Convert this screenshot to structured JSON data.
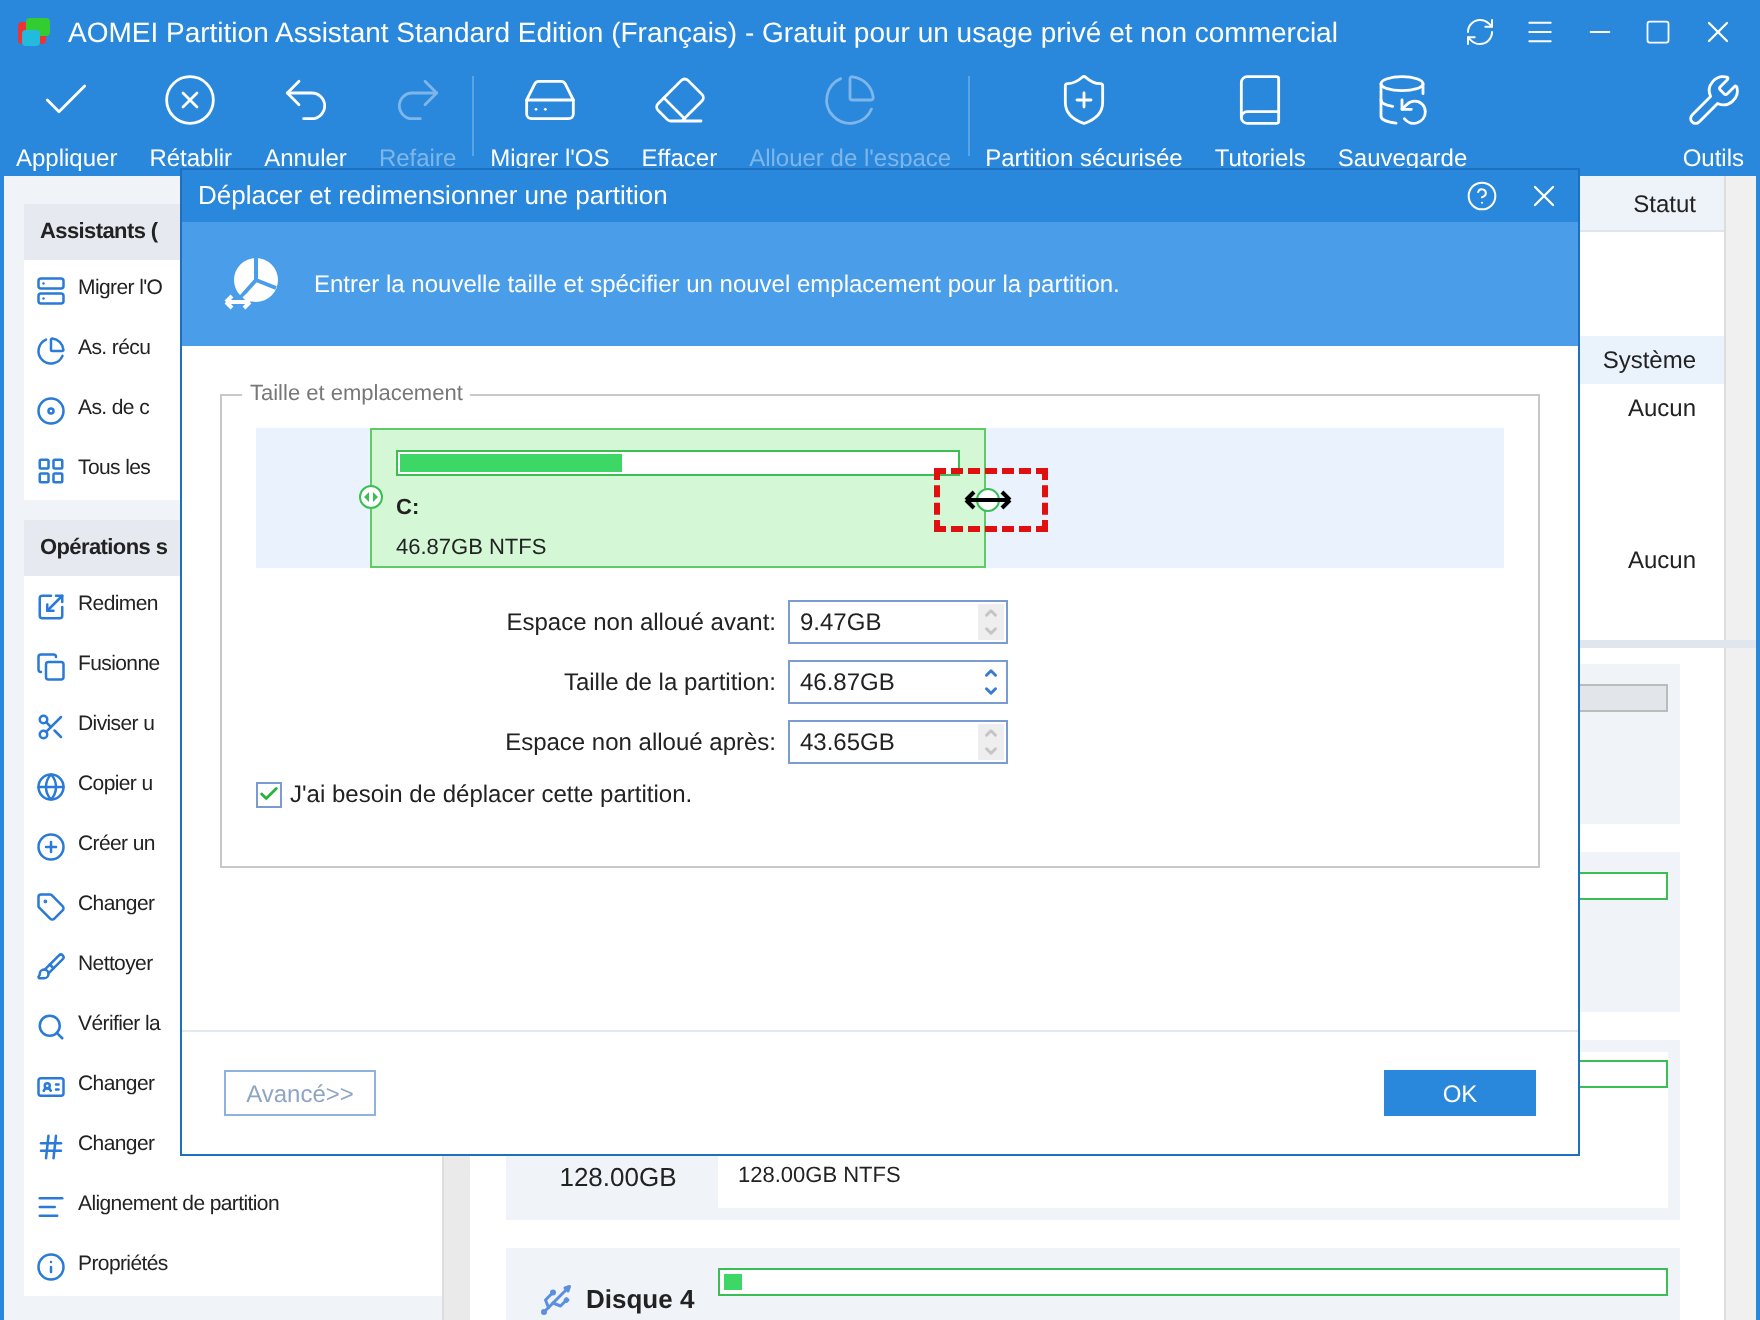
{
  "window": {
    "title": "AOMEI Partition Assistant Standard Edition (Français) - Gratuit pour un usage privé et non commercial"
  },
  "toolbar": [
    {
      "label": "Appliquer",
      "disabled": false
    },
    {
      "label": "Rétablir",
      "disabled": false
    },
    {
      "label": "Annuler",
      "disabled": false
    },
    {
      "label": "Refaire",
      "disabled": true
    },
    {
      "label": "Migrer l'OS",
      "disabled": false
    },
    {
      "label": "Effacer",
      "disabled": false
    },
    {
      "label": "Allouer de l'espace",
      "disabled": true
    },
    {
      "label": "Partition sécurisée",
      "disabled": false
    },
    {
      "label": "Tutoriels",
      "disabled": false
    },
    {
      "label": "Sauvegarde",
      "disabled": false
    },
    {
      "label": "Outils",
      "disabled": false
    }
  ],
  "sidebar": [
    {
      "title": "Assistants (",
      "items": [
        "Migrer l'O",
        "As. récu",
        "As. de c",
        "Tous les"
      ]
    },
    {
      "title": "Opérations s",
      "items": [
        "Redimen",
        "Fusionne",
        "Diviser u",
        "Copier u",
        "Créer un",
        "Changer",
        "Nettoyer",
        "Vérifier la",
        "Changer",
        "Changer",
        "Alignement de partition",
        "Propriétés"
      ]
    }
  ],
  "disk_table": {
    "columns": [
      "Statut"
    ],
    "rows": [
      {
        "status": "Système",
        "selected": true
      },
      {
        "status": "Aucun",
        "selected": false
      },
      {
        "status": "Aucun",
        "selected": false
      }
    ]
  },
  "disk_map": [
    {
      "capacity": "128.00GB",
      "partition": "128.00GB NTFS"
    },
    {
      "name": "Disque 4",
      "level": 0.02
    }
  ],
  "dialog": {
    "title": "Déplacer et redimensionner une partition",
    "description": "Entrer la nouvelle taille et spécifier un nouvel emplacement pour la partition.",
    "group_title": "Taille et emplacement",
    "partition": {
      "letter": "C:",
      "info": "46.87GB NTFS",
      "level": 0.4
    },
    "fields": [
      {
        "label": "Espace non alloué avant:",
        "value": "9.47GB",
        "disabled": true
      },
      {
        "label": "Taille de la partition:",
        "value": "46.87GB",
        "disabled": false
      },
      {
        "label": "Espace non alloué après:",
        "value": "43.65GB",
        "disabled": true
      }
    ],
    "move_checkbox": {
      "label": "J'ai besoin de déplacer cette partition.",
      "checked": true
    },
    "buttons": [
      {
        "label": "Avancé>>",
        "kind": "secondary"
      },
      {
        "label": "OK",
        "kind": "primary"
      }
    ]
  }
}
